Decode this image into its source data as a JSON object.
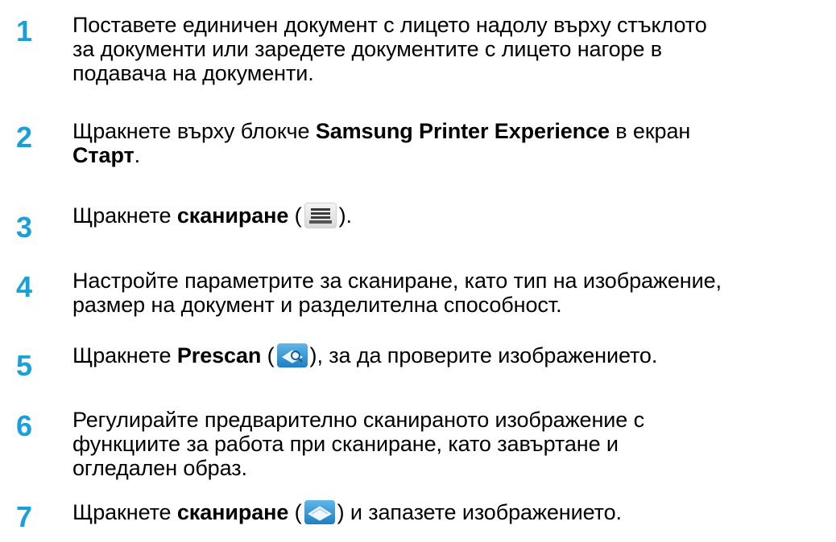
{
  "steps": [
    {
      "number": "1",
      "lines": [
        "Поставете единичен документ с лицето надолу върху стъклото",
        "за документи или заредете документите с лицето нагоре в",
        "подавача на документи."
      ]
    },
    {
      "number": "2",
      "line1_before": "Щракнете върху блокче ",
      "line1_bold": "Samsung Printer Experience",
      "line1_after": " в екран",
      "line2_bold": "Старт",
      "line2_after": "."
    },
    {
      "number": "3",
      "before": "Щракнете ",
      "bold": "сканиране",
      "paren_open": " (",
      "paren_close": ").",
      "icon": "scanner-icon"
    },
    {
      "number": "4",
      "lines": [
        "Настройте параметрите за сканиране, като тип на изображение,",
        "размер на документ и разделителна способност."
      ]
    },
    {
      "number": "5",
      "before": "Щракнете ",
      "bold": "Prescan",
      "paren_open": " (",
      "after": "), за да проверите изображението.",
      "icon": "prescan-icon"
    },
    {
      "number": "6",
      "lines": [
        "Регулирайте предварително сканираното изображение с",
        "функциите за работа при сканиране, като завъртане и",
        "огледален образ."
      ]
    },
    {
      "number": "7",
      "before": "Щракнете ",
      "bold": "сканиране",
      "paren_open": " (",
      "after": ") и запазете изображението.",
      "icon": "scan-button-icon"
    }
  ],
  "colors": {
    "step_number": "#1aa0d8",
    "text": "#000000"
  }
}
